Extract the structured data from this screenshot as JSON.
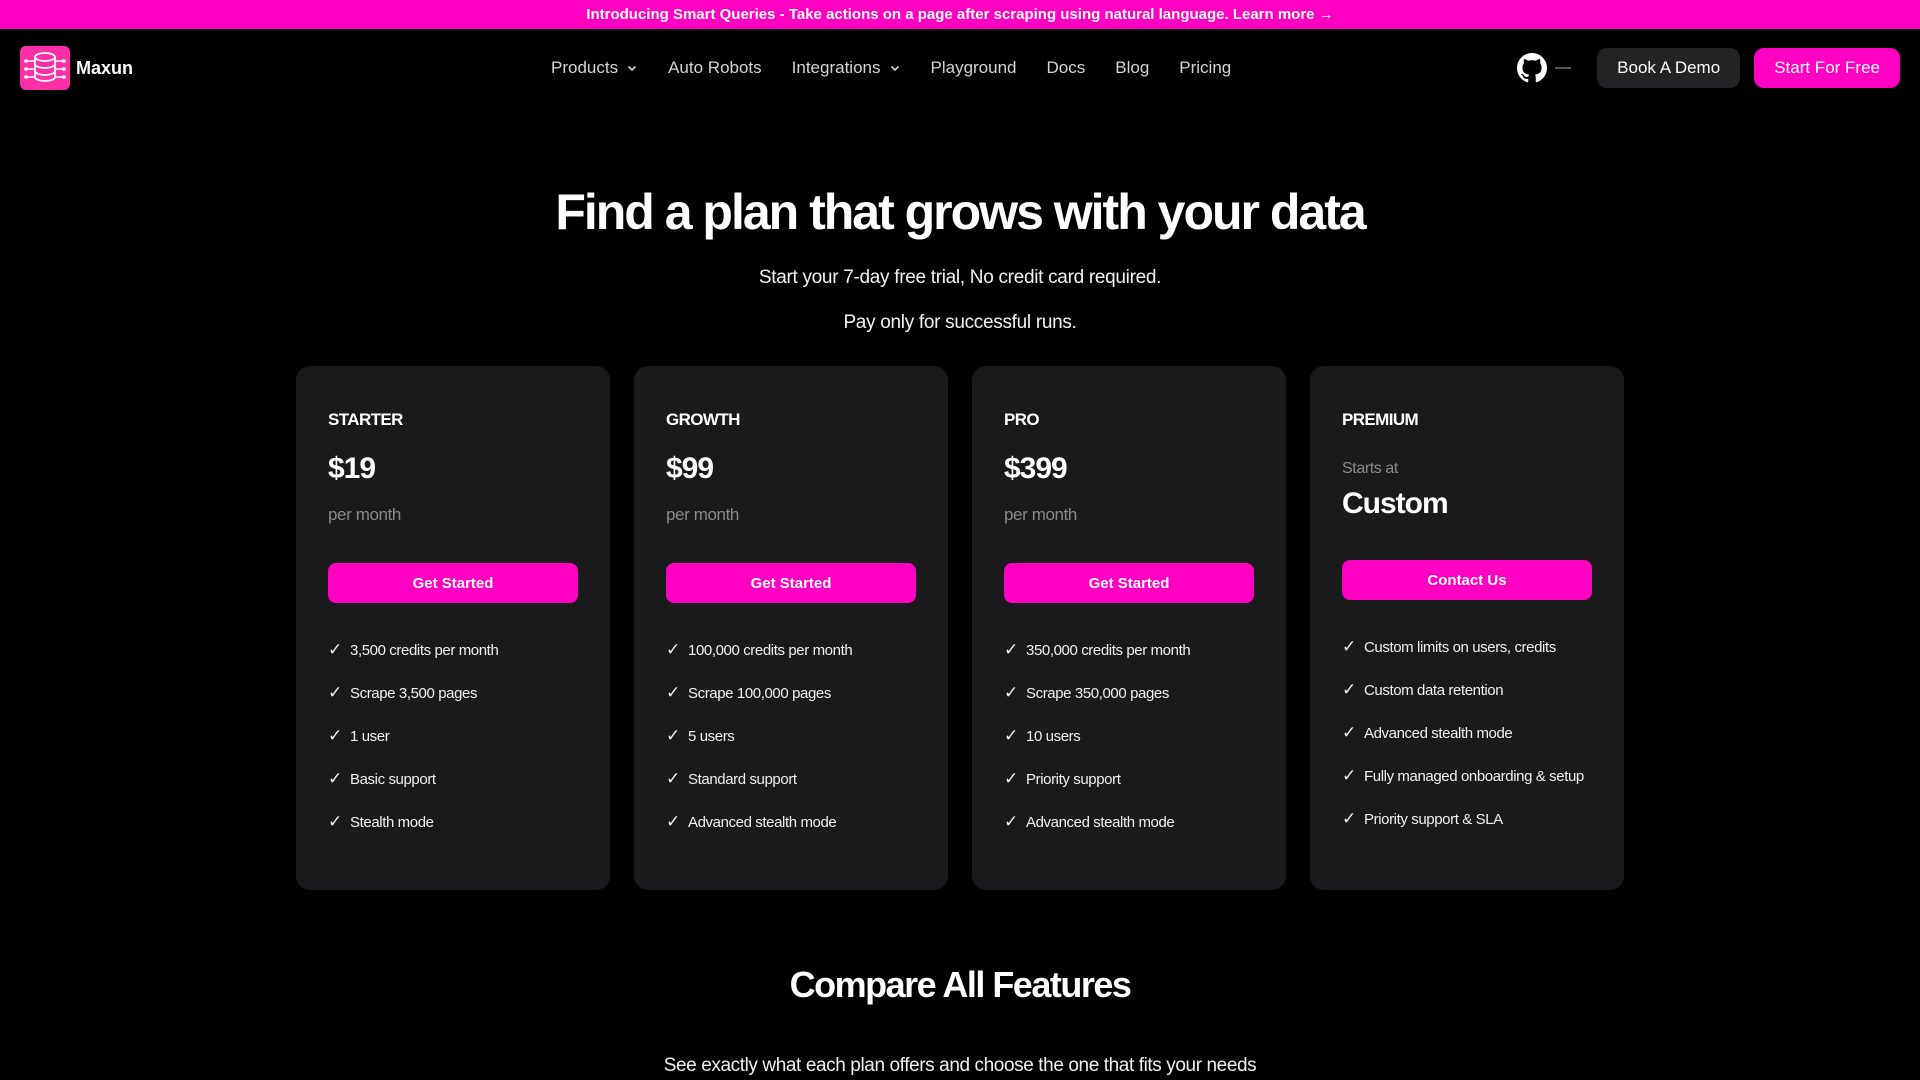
{
  "banner": {
    "text": "Introducing Smart Queries - Take actions on a page after scraping using natural language. Learn more →"
  },
  "brand": {
    "name": "Maxun",
    "accent": "#ff00c3"
  },
  "nav": {
    "items": [
      {
        "label": "Products",
        "has_dropdown": true
      },
      {
        "label": "Auto Robots",
        "has_dropdown": false
      },
      {
        "label": "Integrations",
        "has_dropdown": true
      },
      {
        "label": "Playground",
        "has_dropdown": false
      },
      {
        "label": "Docs",
        "has_dropdown": false
      },
      {
        "label": "Blog",
        "has_dropdown": false
      },
      {
        "label": "Pricing",
        "has_dropdown": false
      }
    ],
    "github_icon": "github-icon",
    "github_count": "—",
    "book_demo": "Book A Demo",
    "start_free": "Start For Free"
  },
  "hero": {
    "title": "Find a plan that grows with your data",
    "subtitle1": "Start your 7-day free trial, No credit card required.",
    "subtitle2": "Pay only for successful runs."
  },
  "plans": [
    {
      "name": "STARTER",
      "price": "$19",
      "period": "per month",
      "cta": "Get Started",
      "features": [
        "3,500 credits per month",
        "Scrape 3,500 pages",
        "1 user",
        "Basic support",
        "Stealth mode"
      ]
    },
    {
      "name": "GROWTH",
      "price": "$99",
      "period": "per month",
      "cta": "Get Started",
      "features": [
        "100,000 credits per month",
        "Scrape 100,000 pages",
        "5 users",
        "Standard support",
        "Advanced stealth mode"
      ]
    },
    {
      "name": "PRO",
      "price": "$399",
      "period": "per month",
      "cta": "Get Started",
      "features": [
        "350,000 credits per month",
        "Scrape 350,000 pages",
        "10 users",
        "Priority support",
        "Advanced stealth mode"
      ]
    },
    {
      "name": "PREMIUM",
      "starts": "Starts at",
      "price": "Custom",
      "cta": "Contact Us",
      "features": [
        "Custom limits on users, credits",
        "Custom data retention",
        "Advanced stealth mode",
        "Fully managed onboarding & setup",
        "Priority support & SLA"
      ]
    }
  ],
  "check_glyph": "✓",
  "compare": {
    "title": "Compare All Features",
    "subtitle": "See exactly what each plan offers and choose the one that fits your needs"
  }
}
